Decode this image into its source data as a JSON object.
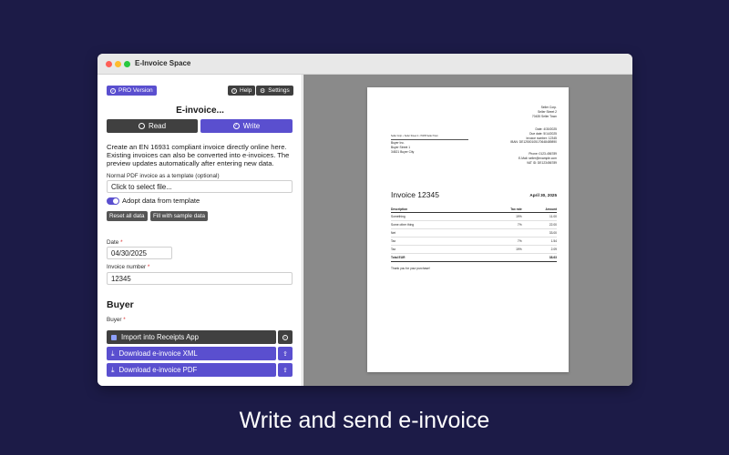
{
  "app": {
    "title": "E-Invoice Space"
  },
  "toolbar": {
    "pro_label": "PRO Version",
    "help_label": "Help",
    "settings_label": "Settings"
  },
  "mode": {
    "heading": "E-invoice...",
    "read_label": "Read",
    "write_label": "Write"
  },
  "intro": "Create an EN 16931 compliant invoice directly online here. Existing invoices can also be converted into e-invoices. The preview updates automatically after entering new data.",
  "template": {
    "label": "Normal PDF invoice as a template (optional)",
    "placeholder": "Click to select file...",
    "adopt_label": "Adopt data from template"
  },
  "buttons": {
    "reset": "Reset all data",
    "sample": "Fill with sample data"
  },
  "form": {
    "date_label": "Date",
    "date_value": "04/30/2025",
    "number_label": "Invoice number",
    "number_value": "12345",
    "required": "*",
    "buyer_section": "Buyer",
    "buyer_label": "Buyer"
  },
  "actions": {
    "import": "Import into Receipts App",
    "xml": "Download e-invoice XML",
    "pdf": "Download e-invoice PDF"
  },
  "doc": {
    "seller": [
      "Seller Corp.",
      "Seller Street 2",
      "70435 Seller Town"
    ],
    "sender_line": "Seller Corp. • Seller Street 2 • 70435 Seller Town",
    "buyer": [
      "Buyer Inc.",
      "Buyer Street 1",
      "34521 Buyer City"
    ],
    "meta": [
      "Date: 4/30/2025",
      "Due date: 5/14/2025",
      "Invoice number: 12345",
      "IBAN: DE12500105170648489890"
    ],
    "contact": [
      "Phone: 0123-456789",
      "E-Mail: seller@example.com",
      "VAT ID: DE123456789"
    ],
    "title": "Invoice 12345",
    "date": "April 30, 2025",
    "columns": {
      "description": "Description",
      "tax": "Tax rate",
      "amount": "Amount"
    },
    "rows": [
      {
        "description": "Something",
        "tax": "19%",
        "amount": "11.00"
      },
      {
        "description": "Some other thing",
        "tax": "7%",
        "amount": "22.00"
      }
    ],
    "net": {
      "label": "Net",
      "amount": "33.00"
    },
    "taxes": [
      {
        "label": "Tax",
        "rate": "7%",
        "amount": "1.54"
      },
      {
        "label": "Tax",
        "rate": "19%",
        "amount": "2.09"
      }
    ],
    "total": {
      "label": "Total EUR",
      "amount": "38.63"
    },
    "thanks": "Thank you for your purchase!"
  },
  "caption": "Write and send e-invoice",
  "colors": {
    "background": "#1c1b47",
    "accent": "#5a4fcf",
    "dark_button": "#404040"
  }
}
